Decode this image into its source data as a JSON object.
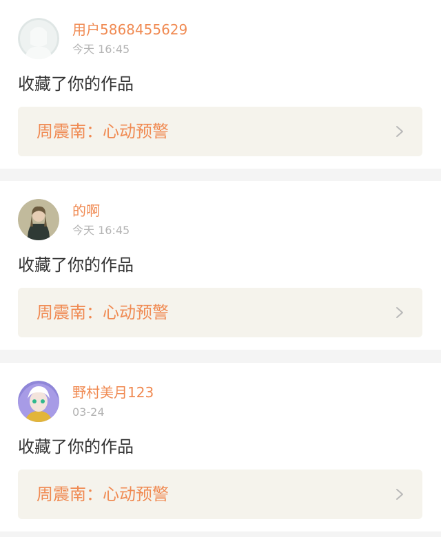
{
  "notifications": [
    {
      "user": "用户5868455629",
      "time": "今天 16:45",
      "action": "收藏了你的作品",
      "work_title": "周震南：心动预警",
      "avatar_icon": "default-user-avatar-icon"
    },
    {
      "user": "的啊",
      "time": "今天 16:45",
      "action": "收藏了你的作品",
      "work_title": "周震南：心动预警",
      "avatar_icon": "user-photo-avatar-icon"
    },
    {
      "user": "野村美月123",
      "time": "03-24",
      "action": "收藏了你的作品",
      "work_title": "周震南：心动预警",
      "avatar_icon": "anime-avatar-icon"
    }
  ],
  "colors": {
    "accent": "#f08a52",
    "timestamp": "#b3b3b3",
    "body_text": "#333333",
    "work_box": "#f5f3ec",
    "page_bg": "#f4f4f4"
  }
}
